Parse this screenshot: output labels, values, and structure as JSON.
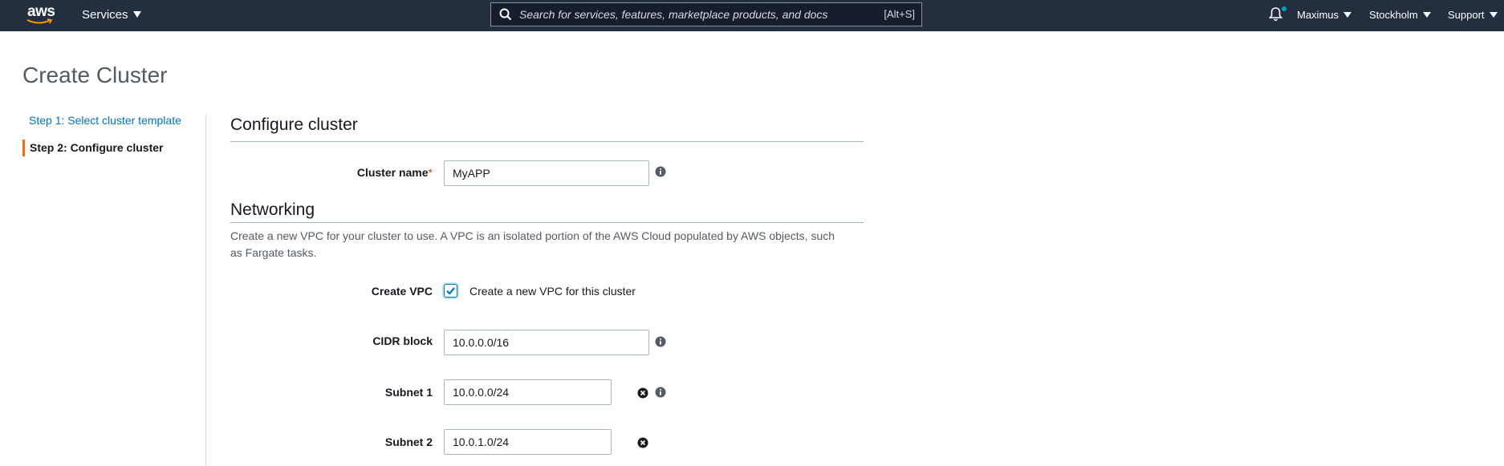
{
  "nav": {
    "logo": "aws",
    "services": "Services",
    "search_placeholder": "Search for services, features, marketplace products, and docs",
    "search_shortcut": "[Alt+S]",
    "user": "Maximus",
    "region": "Stockholm",
    "support": "Support",
    "icons": [
      "search-icon",
      "bell-icon"
    ]
  },
  "page": {
    "title": "Create Cluster"
  },
  "steps": [
    {
      "label": "Step 1: Select cluster template",
      "active": false
    },
    {
      "label": "Step 2: Configure cluster",
      "active": true
    }
  ],
  "configure": {
    "heading": "Configure cluster",
    "cluster_name_label": "Cluster name",
    "required_mark": "*",
    "cluster_name_value": "MyAPP"
  },
  "networking": {
    "heading": "Networking",
    "description": "Create a new VPC for your cluster to use. A VPC is an isolated portion of the AWS Cloud populated by AWS objects, such as Fargate tasks.",
    "create_vpc_label": "Create VPC",
    "create_vpc_checked": true,
    "create_vpc_option": "Create a new VPC for this cluster",
    "cidr_label": "CIDR block",
    "cidr_value": "10.0.0.0/16",
    "subnets": [
      {
        "label": "Subnet 1",
        "value": "10.0.0.0/24"
      },
      {
        "label": "Subnet 2",
        "value": "10.0.1.0/24"
      }
    ]
  },
  "colors": {
    "nav_bg": "#232f3e",
    "link": "#0073bb",
    "active_step": "#ec7211"
  }
}
